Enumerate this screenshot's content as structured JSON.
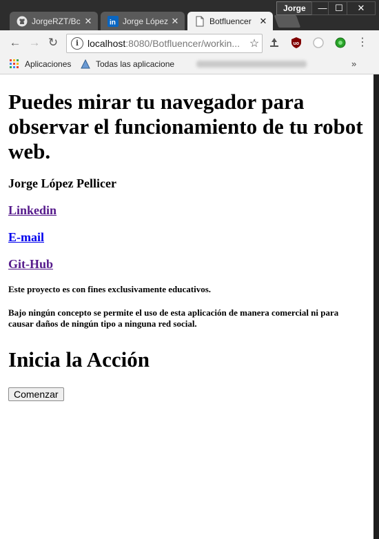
{
  "window": {
    "profile_name": "Jorge",
    "min_glyph": "—",
    "max_glyph": "☐",
    "close_glyph": "✕"
  },
  "tabs": [
    {
      "title": "JorgeRZT/Bc",
      "icon": "github-icon"
    },
    {
      "title": "Jorge López",
      "icon": "linkedin-icon"
    },
    {
      "title": "Botfluencer",
      "icon": "page-icon",
      "active": true
    }
  ],
  "toolbar": {
    "url_host": "localhost",
    "url_path": ":8080/Botfluencer/workin..."
  },
  "bookmarks": {
    "apps_label": "Aplicaciones",
    "all_apps_label": "Todas las aplicacione",
    "more_glyph": "»"
  },
  "page": {
    "heading": "Puedes mirar tu navegador para observar el funcionamiento de tu robot web.",
    "author": "Jorge López Pellicer",
    "linkedin": "Linkedin",
    "email": "E-mail",
    "github": "Git-Hub",
    "note1": "Este proyecto es con fines exclusivamente educativos.",
    "note2": "Bajo ningún concepto se permite el uso de esta aplicación de manera comercial ni para causar daños de ningún tipo a ninguna red social.",
    "section_title": "Inicia la Acción",
    "start_button": "Comenzar"
  }
}
